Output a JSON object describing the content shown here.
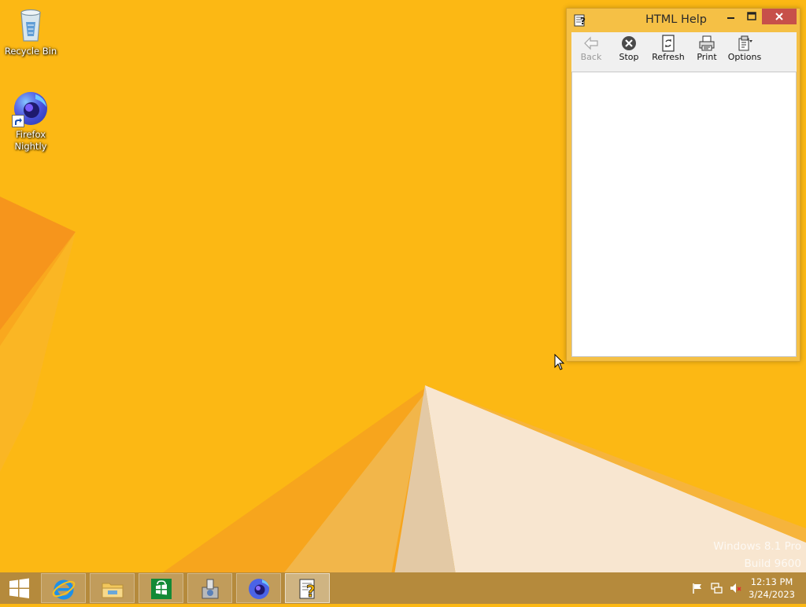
{
  "desktop": {
    "icons": [
      {
        "label": "Recycle Bin",
        "icon": "recycle-bin-icon"
      },
      {
        "label": "Firefox Nightly",
        "icon": "firefox-nightly-icon",
        "shortcut": true
      }
    ]
  },
  "help_window": {
    "title": "HTML Help",
    "title_icon": "help-book-icon",
    "toolbar": [
      {
        "label": "Back",
        "icon": "back-arrow-icon",
        "enabled": false
      },
      {
        "label": "Stop",
        "icon": "stop-icon",
        "enabled": true
      },
      {
        "label": "Refresh",
        "icon": "refresh-icon",
        "enabled": true
      },
      {
        "label": "Print",
        "icon": "printer-icon",
        "enabled": true
      },
      {
        "label": "Options",
        "icon": "options-icon",
        "enabled": true
      }
    ]
  },
  "watermark": {
    "line1": "Windows 8.1 Pro",
    "line2": "Build 9600"
  },
  "taskbar": {
    "apps": [
      {
        "name": "Internet Explorer",
        "icon": "internet-explorer-icon",
        "active": false
      },
      {
        "name": "File Explorer",
        "icon": "file-explorer-icon",
        "active": false
      },
      {
        "name": "Store",
        "icon": "store-icon",
        "active": false
      },
      {
        "name": "Setup",
        "icon": "installer-icon",
        "active": false
      },
      {
        "name": "Firefox Nightly",
        "icon": "firefox-nightly-icon",
        "active": false
      },
      {
        "name": "HTML Help",
        "icon": "help-book-icon",
        "active": true
      }
    ],
    "tray_icons": [
      "action-center-flag-icon",
      "network-icon",
      "volume-muted-icon"
    ],
    "time": "12:13 PM",
    "date": "3/24/2023"
  },
  "colors": {
    "wallpaper": "#fcb814",
    "taskbar": "#b58a3c",
    "close_button": "#c7504a",
    "window_frame": "#f5c045"
  }
}
